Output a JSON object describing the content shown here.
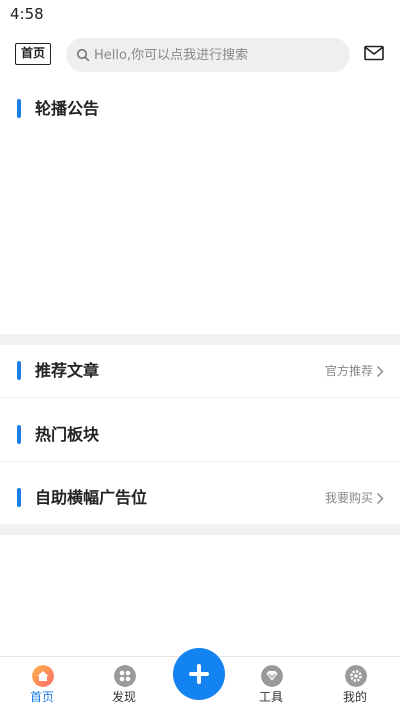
{
  "status_bar": {
    "time": "4:58"
  },
  "header": {
    "home_badge": "首页",
    "search_placeholder": "Hello,你可以点我进行搜索"
  },
  "sections": {
    "announcement": {
      "title": "轮播公告"
    },
    "recommended": {
      "title": "推荐文章",
      "link": "官方推荐"
    },
    "hot_boards": {
      "title": "热门板块"
    },
    "banner_ads": {
      "title": "自助横幅广告位",
      "link": "我要购买"
    }
  },
  "tab_bar": {
    "items": [
      {
        "label": "首页",
        "icon": "home-icon",
        "active": true
      },
      {
        "label": "发现",
        "icon": "discover-icon",
        "active": false
      },
      {
        "label": "",
        "icon": "plus-icon",
        "active": false
      },
      {
        "label": "工具",
        "icon": "tools-icon",
        "active": false
      },
      {
        "label": "我的",
        "icon": "settings-icon",
        "active": false
      }
    ]
  },
  "colors": {
    "accent": "#1a7ee6",
    "fab": "#1283f0",
    "section_gap": "#f1f1f1"
  }
}
